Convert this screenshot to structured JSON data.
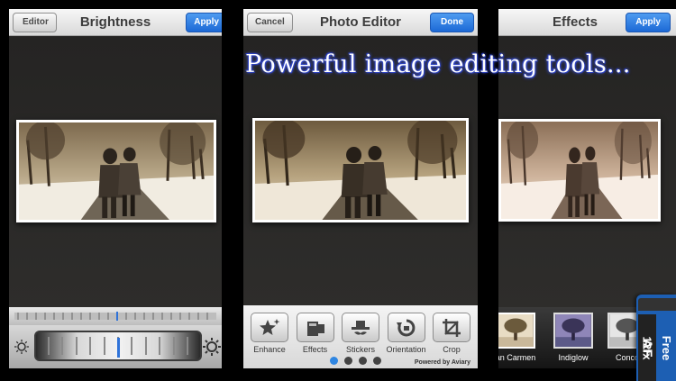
{
  "brightness_screen": {
    "title": "Brightness",
    "back_label": "Editor",
    "apply_label": "Apply",
    "icons": [
      "sun-small-icon",
      "sun-large-icon"
    ]
  },
  "editor_screen": {
    "title": "Photo Editor",
    "cancel_label": "Cancel",
    "done_label": "Done",
    "tools": [
      {
        "label": "Enhance",
        "icon": "enhance-icon"
      },
      {
        "label": "Effects",
        "icon": "effects-icon"
      },
      {
        "label": "Stickers",
        "icon": "stickers-icon"
      },
      {
        "label": "Orientation",
        "icon": "orientation-icon"
      },
      {
        "label": "Crop",
        "icon": "crop-icon"
      }
    ],
    "page_dots": 4,
    "active_dot": 0,
    "powered_by": "Powered by Aviary"
  },
  "effects_screen": {
    "title": "Effects",
    "apply_label": "Apply",
    "filters": [
      "an Carmen",
      "Indiglow",
      "Conco"
    ],
    "badge": {
      "left": "AF",
      "right": "12fx",
      "corner": "Free"
    }
  },
  "headline": "Powerful image editing tools...",
  "colors": {
    "accent_blue": "#2f86e2",
    "nav_bg": "#e6e6e6",
    "badge_blue": "#1d5fb3"
  }
}
